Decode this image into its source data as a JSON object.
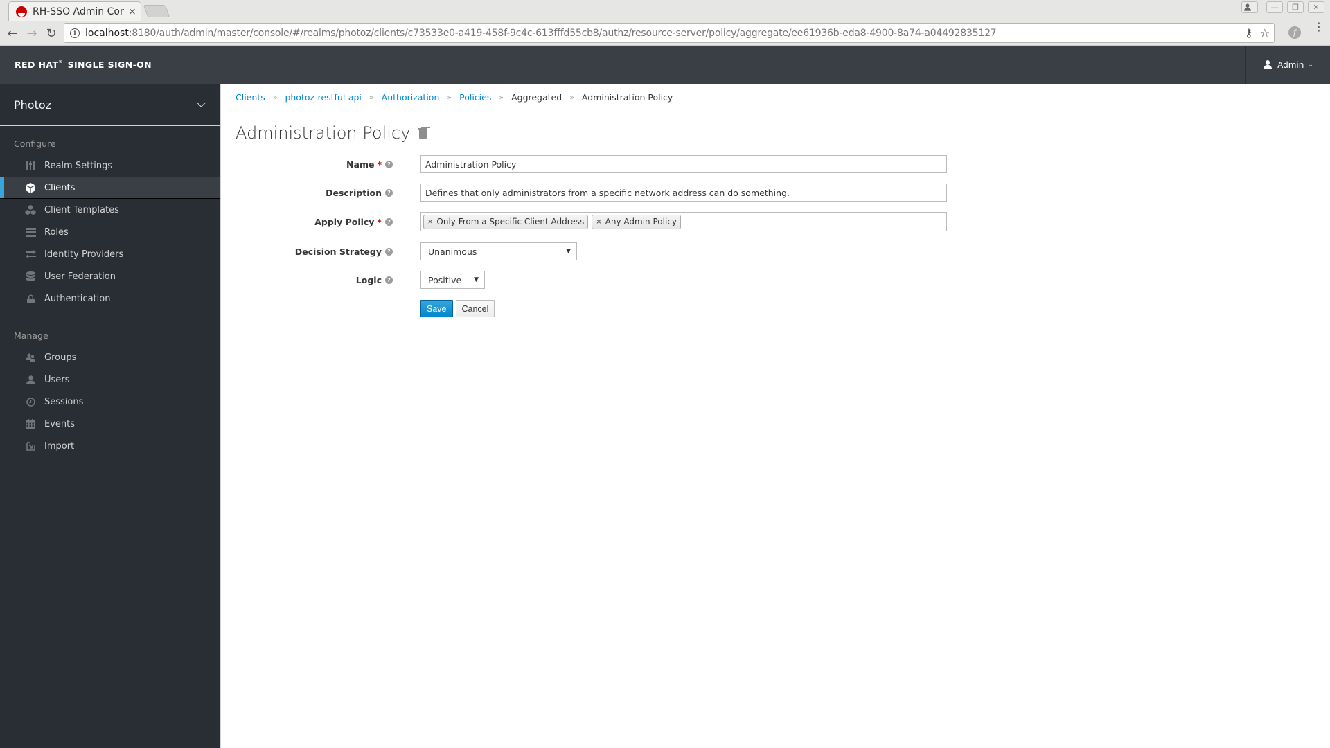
{
  "browser": {
    "tab_title": "RH-SSO Admin Cons",
    "tab_close": "×",
    "url_host": "localhost",
    "url_rest": ":8180/auth/admin/master/console/#/realms/photoz/clients/c73533e0-a419-458f-9c4c-613fffd55cb8/authz/resource-server/policy/aggregate/ee61936b-eda8-4900-8a74-a04492835127",
    "back": "←",
    "forward": "→",
    "reload": "↻",
    "key_icon": "⚷",
    "star_icon": "☆",
    "ext_icon": "f",
    "menu_icon": "⋮",
    "window_minimize": "—",
    "window_restore": "❐",
    "window_close": "✕"
  },
  "header": {
    "brand_part1": "RED HAT",
    "brand_tm": "®",
    "brand_part2": "SINGLE SIGN-ON",
    "user_label": "Admin",
    "user_caret": "⌄"
  },
  "sidebar": {
    "realm": "Photoz",
    "configure_title": "Configure",
    "configure_items": [
      {
        "label": "Realm Settings",
        "icon": "sliders-icon",
        "active": false
      },
      {
        "label": "Clients",
        "icon": "cube-icon",
        "active": true
      },
      {
        "label": "Client Templates",
        "icon": "cubes-icon",
        "active": false
      },
      {
        "label": "Roles",
        "icon": "list-icon",
        "active": false
      },
      {
        "label": "Identity Providers",
        "icon": "exchange-icon",
        "active": false
      },
      {
        "label": "User Federation",
        "icon": "database-icon",
        "active": false
      },
      {
        "label": "Authentication",
        "icon": "lock-icon",
        "active": false
      }
    ],
    "manage_title": "Manage",
    "manage_items": [
      {
        "label": "Groups",
        "icon": "users-icon"
      },
      {
        "label": "Users",
        "icon": "user-icon"
      },
      {
        "label": "Sessions",
        "icon": "clock-icon"
      },
      {
        "label": "Events",
        "icon": "calendar-icon"
      },
      {
        "label": "Import",
        "icon": "import-icon"
      }
    ]
  },
  "breadcrumb": {
    "items": [
      "Clients",
      "photoz-restful-api",
      "Authorization",
      "Policies",
      "Aggregated",
      "Administration Policy"
    ],
    "separator": "»"
  },
  "page": {
    "title": "Administration Policy"
  },
  "form": {
    "name_label": "Name",
    "name_value": "Administration Policy",
    "description_label": "Description",
    "description_value": "Defines that only administrators from a specific network address can do something.",
    "apply_policy_label": "Apply Policy",
    "apply_policy_tags": [
      "Only From a Specific Client Address",
      "Any Admin Policy"
    ],
    "decision_strategy_label": "Decision Strategy",
    "decision_strategy_value": "Unanimous",
    "logic_label": "Logic",
    "logic_value": "Positive",
    "required_mark": "*",
    "help_mark": "?",
    "tag_remove": "×",
    "select_caret": "▼",
    "save_label": "Save",
    "cancel_label": "Cancel"
  },
  "colors": {
    "link": "#0088ce",
    "primary_button": "#0088ce",
    "active_indicator": "#39a5dc",
    "header_bg": "#393f44",
    "sidebar_bg": "#292e34",
    "required": "#cc0000"
  }
}
